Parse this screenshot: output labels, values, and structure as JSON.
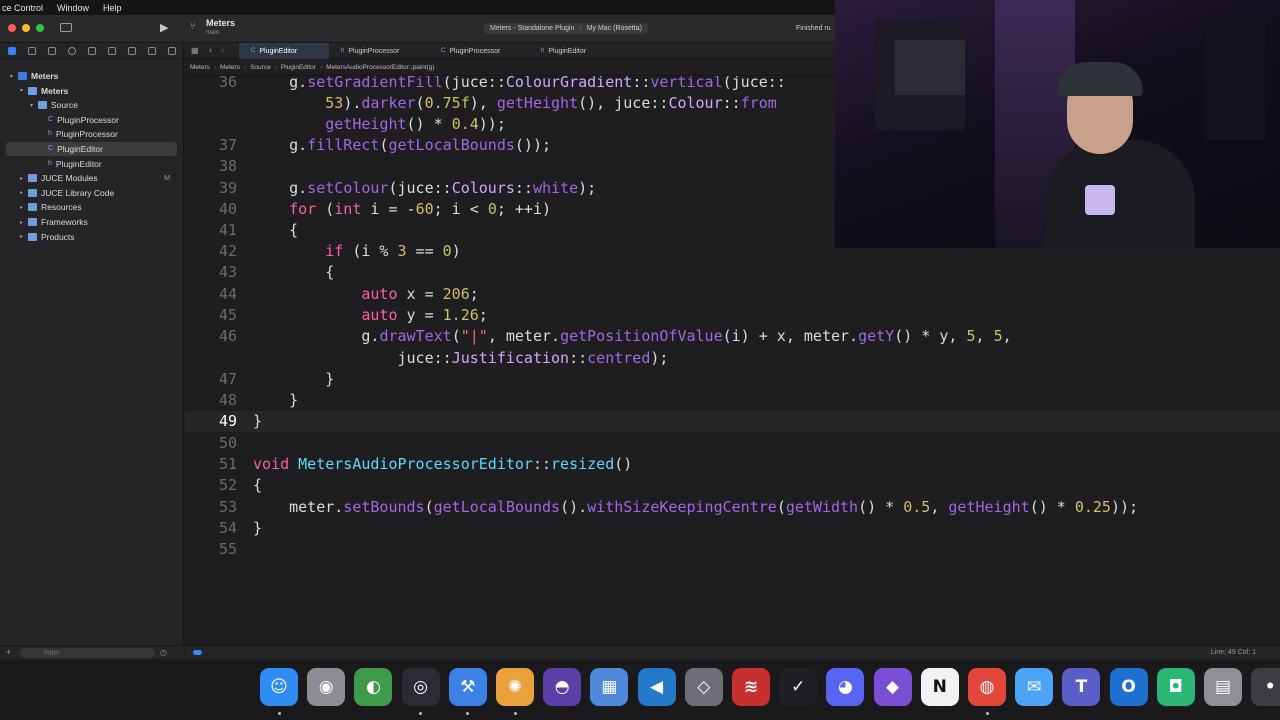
{
  "menubar": {
    "items": [
      "ce Control",
      "Window",
      "Help"
    ]
  },
  "toolbar": {
    "project_name": "Meters",
    "branch": "main",
    "scheme": "Meters - Standalone Plugin",
    "destination": "My Mac (Rosetta)",
    "status": "Finished ru"
  },
  "navigator": {
    "filter_placeholder": "Filter",
    "items": [
      {
        "label": "Meters",
        "type": "project",
        "disclosure": "▾",
        "indent": 0
      },
      {
        "label": "Meters",
        "type": "folder",
        "disclosure": "▾",
        "indent": 1
      },
      {
        "label": "Source",
        "type": "folder",
        "disclosure": "▾",
        "indent": 2
      },
      {
        "label": "PluginProcessor",
        "type": "c",
        "disclosure": "",
        "indent": 3
      },
      {
        "label": "PluginProcessor",
        "type": "h",
        "disclosure": "",
        "indent": 3
      },
      {
        "label": "PluginEditor",
        "type": "c",
        "disclosure": "",
        "indent": 3,
        "selected": true
      },
      {
        "label": "PluginEditor",
        "type": "h",
        "disclosure": "",
        "indent": 3
      },
      {
        "label": "JUCE Modules",
        "type": "folder",
        "disclosure": "▸",
        "indent": 1,
        "badge": "M"
      },
      {
        "label": "JUCE Library Code",
        "type": "folder",
        "disclosure": "▸",
        "indent": 1
      },
      {
        "label": "Resources",
        "type": "folder",
        "disclosure": "▸",
        "indent": 1
      },
      {
        "label": "Frameworks",
        "type": "folder",
        "disclosure": "▸",
        "indent": 1
      },
      {
        "label": "Products",
        "type": "folder",
        "disclosure": "▸",
        "indent": 1
      }
    ]
  },
  "tabs": [
    {
      "label": "PluginEditor",
      "active": true
    },
    {
      "label": "PluginProcessor",
      "active": false
    },
    {
      "label": "PluginProcessor",
      "active": false
    },
    {
      "label": "PluginEditor",
      "active": false
    }
  ],
  "jumpbar": [
    "Meters",
    "Meters",
    "Source",
    "PluginEditor",
    "MetersAudioProcessorEditor::paint(g)"
  ],
  "editor": {
    "lines": [
      {
        "n": "36",
        "t": [
          [
            "    g.",
            "p"
          ],
          [
            "setGradientFill",
            "f"
          ],
          [
            "(juce::",
            "p"
          ],
          [
            "ColourGradient",
            "t"
          ],
          [
            "::",
            "p"
          ],
          [
            "vertical",
            "f"
          ],
          [
            "(juce::",
            "p"
          ]
        ]
      },
      {
        "n": "",
        "t": [
          [
            "        ",
            "p"
          ],
          [
            "53",
            "n"
          ],
          [
            ").",
            "p"
          ],
          [
            "darker",
            "f"
          ],
          [
            "(",
            "p"
          ],
          [
            "0.75f",
            "n"
          ],
          [
            "), ",
            "p"
          ],
          [
            "getHeight",
            "f"
          ],
          [
            "(), juce::",
            "p"
          ],
          [
            "Colour",
            "t"
          ],
          [
            "::",
            "p"
          ],
          [
            "from",
            "f"
          ]
        ]
      },
      {
        "n": "",
        "t": [
          [
            "        ",
            "p"
          ],
          [
            "getHeight",
            "f"
          ],
          [
            "() * ",
            "p"
          ],
          [
            "0.4",
            "n"
          ],
          [
            "));",
            "p"
          ]
        ]
      },
      {
        "n": "37",
        "t": [
          [
            "    g.",
            "p"
          ],
          [
            "fillRect",
            "f"
          ],
          [
            "(",
            "p"
          ],
          [
            "getLocalBounds",
            "f"
          ],
          [
            "());",
            "p"
          ]
        ]
      },
      {
        "n": "38",
        "t": []
      },
      {
        "n": "39",
        "t": [
          [
            "    g.",
            "p"
          ],
          [
            "setColour",
            "f"
          ],
          [
            "(juce::",
            "p"
          ],
          [
            "Colours",
            "t"
          ],
          [
            "::",
            "p"
          ],
          [
            "white",
            "f"
          ],
          [
            ");",
            "p"
          ]
        ]
      },
      {
        "n": "40",
        "t": [
          [
            "    ",
            "p"
          ],
          [
            "for",
            "k"
          ],
          [
            " (",
            "p"
          ],
          [
            "int",
            "k"
          ],
          [
            " i = -",
            "p"
          ],
          [
            "60",
            "n"
          ],
          [
            "; i < ",
            "p"
          ],
          [
            "0",
            "n"
          ],
          [
            "; ++i)",
            "p"
          ]
        ]
      },
      {
        "n": "41",
        "t": [
          [
            "    {",
            "p"
          ]
        ]
      },
      {
        "n": "42",
        "t": [
          [
            "        ",
            "p"
          ],
          [
            "if",
            "k"
          ],
          [
            " (i % ",
            "p"
          ],
          [
            "3",
            "n"
          ],
          [
            " == ",
            "p"
          ],
          [
            "0",
            "n"
          ],
          [
            ")",
            "p"
          ]
        ]
      },
      {
        "n": "43",
        "t": [
          [
            "        {",
            "p"
          ]
        ]
      },
      {
        "n": "44",
        "t": [
          [
            "            ",
            "p"
          ],
          [
            "auto",
            "k"
          ],
          [
            " x = ",
            "p"
          ],
          [
            "206",
            "n"
          ],
          [
            ";",
            "p"
          ]
        ]
      },
      {
        "n": "45",
        "t": [
          [
            "            ",
            "p"
          ],
          [
            "auto",
            "k"
          ],
          [
            " y = ",
            "p"
          ],
          [
            "1.26",
            "n"
          ],
          [
            ";",
            "p"
          ]
        ]
      },
      {
        "n": "46",
        "t": [
          [
            "            g.",
            "p"
          ],
          [
            "drawText",
            "f"
          ],
          [
            "(",
            "p"
          ],
          [
            "\"|\"",
            "s"
          ],
          [
            ", meter.",
            "p"
          ],
          [
            "getPositionOfValue",
            "f"
          ],
          [
            "(i) + x, meter.",
            "p"
          ],
          [
            "getY",
            "f"
          ],
          [
            "() * y, ",
            "p"
          ],
          [
            "5",
            "n"
          ],
          [
            ", ",
            "p"
          ],
          [
            "5",
            "n"
          ],
          [
            ",",
            "p"
          ]
        ]
      },
      {
        "n": "",
        "t": [
          [
            "                juce::",
            "p"
          ],
          [
            "Justification",
            "t"
          ],
          [
            "::",
            "p"
          ],
          [
            "centred",
            "f"
          ],
          [
            ");",
            "p"
          ]
        ]
      },
      {
        "n": "47",
        "t": [
          [
            "        }",
            "p"
          ]
        ]
      },
      {
        "n": "48",
        "t": [
          [
            "    }",
            "p"
          ]
        ]
      },
      {
        "n": "49",
        "t": [
          [
            "}",
            "p"
          ]
        ],
        "current": true
      },
      {
        "n": "50",
        "t": []
      },
      {
        "n": "51",
        "t": [
          [
            "void",
            "k"
          ],
          [
            " ",
            "p"
          ],
          [
            "MetersAudioProcessorEditor",
            "d"
          ],
          [
            "::",
            "p"
          ],
          [
            "resized",
            "d"
          ],
          [
            "()",
            "p"
          ]
        ]
      },
      {
        "n": "52",
        "t": [
          [
            "{",
            "p"
          ]
        ]
      },
      {
        "n": "53",
        "t": [
          [
            "    meter.",
            "p"
          ],
          [
            "setBounds",
            "f"
          ],
          [
            "(",
            "p"
          ],
          [
            "getLocalBounds",
            "f"
          ],
          [
            "().",
            "p"
          ],
          [
            "withSizeKeepingCentre",
            "f"
          ],
          [
            "(",
            "p"
          ],
          [
            "getWidth",
            "f"
          ],
          [
            "() * ",
            "p"
          ],
          [
            "0.5",
            "n"
          ],
          [
            ", ",
            "p"
          ],
          [
            "getHeight",
            "f"
          ],
          [
            "() * ",
            "p"
          ],
          [
            "0.25",
            "n"
          ],
          [
            "));",
            "p"
          ]
        ]
      },
      {
        "n": "54",
        "t": [
          [
            "}",
            "p"
          ]
        ]
      },
      {
        "n": "55",
        "t": []
      }
    ]
  },
  "statusbar": {
    "position": "Line: 49  Col: 1"
  },
  "dock": {
    "apps": [
      {
        "name": "finder",
        "glyph": "☺",
        "color": "#2f8cf2",
        "running": true
      },
      {
        "name": "disk-utility",
        "glyph": "◉",
        "color": "#8d8d95",
        "running": false
      },
      {
        "name": "reaper",
        "glyph": "◐",
        "color": "#3d9b4a",
        "running": false
      },
      {
        "name": "obs",
        "glyph": "◎",
        "color": "#2b2b33",
        "running": true
      },
      {
        "name": "xcode",
        "glyph": "⚒",
        "color": "#3c82e6",
        "running": true
      },
      {
        "name": "color-app",
        "glyph": "✺",
        "color": "#e9a13b",
        "running": true
      },
      {
        "name": "github-desktop",
        "glyph": "◓",
        "color": "#5b3ea6",
        "running": false
      },
      {
        "name": "preview",
        "glyph": "▦",
        "color": "#4f89d9",
        "running": false
      },
      {
        "name": "vscode",
        "glyph": "◀",
        "color": "#2479c8",
        "running": false
      },
      {
        "name": "unity",
        "glyph": "◇",
        "color": "#6e6e76",
        "running": false
      },
      {
        "name": "audio-plugin",
        "glyph": "≋",
        "color": "#c8302f",
        "running": false
      },
      {
        "name": "tasks",
        "glyph": "✓",
        "color": "#202024",
        "running": false
      },
      {
        "name": "discord",
        "glyph": "◕",
        "color": "#5865f2",
        "running": false
      },
      {
        "name": "obsidian",
        "glyph": "◆",
        "color": "#7a4fd6",
        "running": false
      },
      {
        "name": "notion",
        "glyph": "N",
        "color": "#f2f2f2",
        "running": false
      },
      {
        "name": "chrome",
        "glyph": "◍",
        "color": "#e3463b",
        "running": true
      },
      {
        "name": "mail",
        "glyph": "✉",
        "color": "#4da3f5",
        "running": false
      },
      {
        "name": "teams",
        "glyph": "T",
        "color": "#5a5fc8",
        "running": false
      },
      {
        "name": "outlook",
        "glyph": "O",
        "color": "#1f6fd1",
        "running": false
      },
      {
        "name": "facetime",
        "glyph": "◘",
        "color": "#2bb673",
        "running": false
      },
      {
        "name": "calculator",
        "glyph": "▤",
        "color": "#8f8f98",
        "running": false
      },
      {
        "name": "more",
        "glyph": "•",
        "color": "#3d3d42",
        "running": false
      }
    ]
  },
  "colors": {
    "accent": "#3b82f6",
    "keyword": "#fc5fa3",
    "number": "#d0bf69",
    "string": "#fc6a5d",
    "function": "#a167e6",
    "declaration": "#5dd8ff",
    "type": "#d0a8ff"
  }
}
